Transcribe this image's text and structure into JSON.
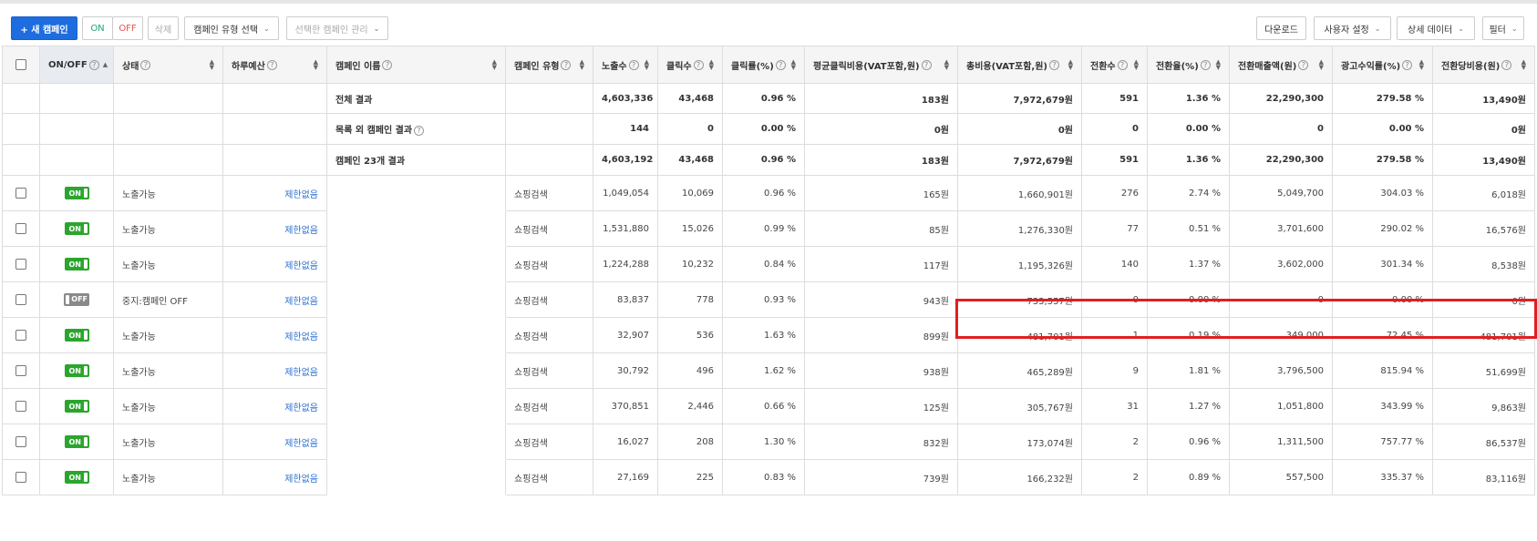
{
  "toolbar": {
    "new_campaign": "+ 새 캠페인",
    "on": "ON",
    "off": "OFF",
    "delete": "삭제",
    "type_select": "캠페인 유형 선택",
    "manage_selected": "선택한 캠페인 관리",
    "download": "다운로드",
    "user_settings": "사용자 설정",
    "detail_data": "상세 데이터",
    "filter": "필터"
  },
  "headers": {
    "onoff": "ON/OFF",
    "status": "상태",
    "daily_budget": "하루예산",
    "campaign_name": "캠페인 이름",
    "campaign_type": "캠페인 유형",
    "impressions": "노출수",
    "clicks": "클릭수",
    "ctr": "클릭률(%)",
    "avg_cpc": "평균클릭비용(VAT포함,원)",
    "total_cost": "총비용(VAT포함,원)",
    "conversions": "전환수",
    "conv_rate": "전환율(%)",
    "conv_revenue": "전환매출액(원)",
    "roas": "광고수익률(%)",
    "cost_per_conv": "전환당비용(원)"
  },
  "summary": [
    {
      "label": "전체 결과",
      "impressions": "4,603,336",
      "clicks": "43,468",
      "ctr": "0.96 %",
      "avg_cpc": "183원",
      "total_cost": "7,972,679원",
      "conversions": "591",
      "conv_rate": "1.36 %",
      "conv_revenue": "22,290,300",
      "roas": "279.58 %",
      "cost_per_conv": "13,490원"
    },
    {
      "label": "목록 외 캠페인 결과",
      "impressions": "144",
      "clicks": "0",
      "ctr": "0.00 %",
      "avg_cpc": "0원",
      "total_cost": "0원",
      "conversions": "0",
      "conv_rate": "0.00 %",
      "conv_revenue": "0",
      "roas": "0.00 %",
      "cost_per_conv": "0원"
    },
    {
      "label": "캠페인 23개 결과",
      "impressions": "4,603,192",
      "clicks": "43,468",
      "ctr": "0.96 %",
      "avg_cpc": "183원",
      "total_cost": "7,972,679원",
      "conversions": "591",
      "conv_rate": "1.36 %",
      "conv_revenue": "22,290,300",
      "roas": "279.58 %",
      "cost_per_conv": "13,490원"
    }
  ],
  "rows": [
    {
      "toggle": "ON",
      "status": "노출가능",
      "budget": "제한없음",
      "type": "쇼핑검색",
      "impressions": "1,049,054",
      "clicks": "10,069",
      "ctr": "0.96 %",
      "avg_cpc": "165원",
      "total_cost": "1,660,901원",
      "conversions": "276",
      "conv_rate": "2.74 %",
      "conv_revenue": "5,049,700",
      "roas": "304.03 %",
      "cost_per_conv": "6,018원"
    },
    {
      "toggle": "ON",
      "status": "노출가능",
      "budget": "제한없음",
      "type": "쇼핑검색",
      "impressions": "1,531,880",
      "clicks": "15,026",
      "ctr": "0.99 %",
      "avg_cpc": "85원",
      "total_cost": "1,276,330원",
      "conversions": "77",
      "conv_rate": "0.51 %",
      "conv_revenue": "3,701,600",
      "roas": "290.02 %",
      "cost_per_conv": "16,576원"
    },
    {
      "toggle": "ON",
      "status": "노출가능",
      "budget": "제한없음",
      "type": "쇼핑검색",
      "impressions": "1,224,288",
      "clicks": "10,232",
      "ctr": "0.84 %",
      "avg_cpc": "117원",
      "total_cost": "1,195,326원",
      "conversions": "140",
      "conv_rate": "1.37 %",
      "conv_revenue": "3,602,000",
      "roas": "301.34 %",
      "cost_per_conv": "8,538원"
    },
    {
      "toggle": "OFF",
      "status": "중지:캠페인 OFF",
      "budget": "제한없음",
      "type": "쇼핑검색",
      "impressions": "83,837",
      "clicks": "778",
      "ctr": "0.93 %",
      "avg_cpc": "943원",
      "total_cost": "733,557원",
      "conversions": "0",
      "conv_rate": "0.00 %",
      "conv_revenue": "0",
      "roas": "0.00 %",
      "cost_per_conv": "0원"
    },
    {
      "toggle": "ON",
      "status": "노출가능",
      "budget": "제한없음",
      "type": "쇼핑검색",
      "impressions": "32,907",
      "clicks": "536",
      "ctr": "1.63 %",
      "avg_cpc": "899원",
      "total_cost": "481,701원",
      "conversions": "1",
      "conv_rate": "0.19 %",
      "conv_revenue": "349,000",
      "roas": "72.45 %",
      "cost_per_conv": "481,701원"
    },
    {
      "toggle": "ON",
      "status": "노출가능",
      "budget": "제한없음",
      "type": "쇼핑검색",
      "impressions": "30,792",
      "clicks": "496",
      "ctr": "1.62 %",
      "avg_cpc": "938원",
      "total_cost": "465,289원",
      "conversions": "9",
      "conv_rate": "1.81 %",
      "conv_revenue": "3,796,500",
      "roas": "815.94 %",
      "cost_per_conv": "51,699원"
    },
    {
      "toggle": "ON",
      "status": "노출가능",
      "budget": "제한없음",
      "type": "쇼핑검색",
      "impressions": "370,851",
      "clicks": "2,446",
      "ctr": "0.66 %",
      "avg_cpc": "125원",
      "total_cost": "305,767원",
      "conversions": "31",
      "conv_rate": "1.27 %",
      "conv_revenue": "1,051,800",
      "roas": "343.99 %",
      "cost_per_conv": "9,863원"
    },
    {
      "toggle": "ON",
      "status": "노출가능",
      "budget": "제한없음",
      "type": "쇼핑검색",
      "impressions": "16,027",
      "clicks": "208",
      "ctr": "1.30 %",
      "avg_cpc": "832원",
      "total_cost": "173,074원",
      "conversions": "2",
      "conv_rate": "0.96 %",
      "conv_revenue": "1,311,500",
      "roas": "757.77 %",
      "cost_per_conv": "86,537원"
    },
    {
      "toggle": "ON",
      "status": "노출가능",
      "budget": "제한없음",
      "type": "쇼핑검색",
      "impressions": "27,169",
      "clicks": "225",
      "ctr": "0.83 %",
      "avg_cpc": "739원",
      "total_cost": "166,232원",
      "conversions": "2",
      "conv_rate": "0.89 %",
      "conv_revenue": "557,500",
      "roas": "335.37 %",
      "cost_per_conv": "83,116원"
    }
  ],
  "colors": {
    "primary": "#1d6de0",
    "on": "#2ca52e",
    "off": "#8a8a8a",
    "link": "#2a6fd0",
    "highlight": "#e02020"
  }
}
